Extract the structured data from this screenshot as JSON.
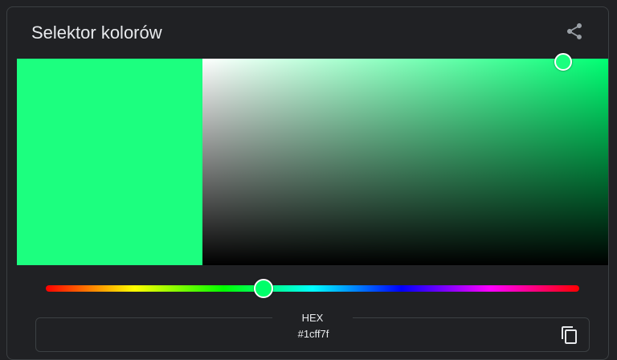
{
  "widget": {
    "title": "Selektor kolorów",
    "share_icon": "share-icon",
    "copy_icon": "copy-icon"
  },
  "color": {
    "hex_label": "HEX",
    "hex_value": "#1cff7f",
    "swatch": "#1cff7f",
    "hue_base": "#00ff6a",
    "hue_degrees": 147,
    "saturation": 0.89,
    "value": 1.0
  },
  "theme": {
    "text": "#e8eaed",
    "icon": "#9aa0a6",
    "background": "#202124",
    "border": "#3c4043"
  }
}
